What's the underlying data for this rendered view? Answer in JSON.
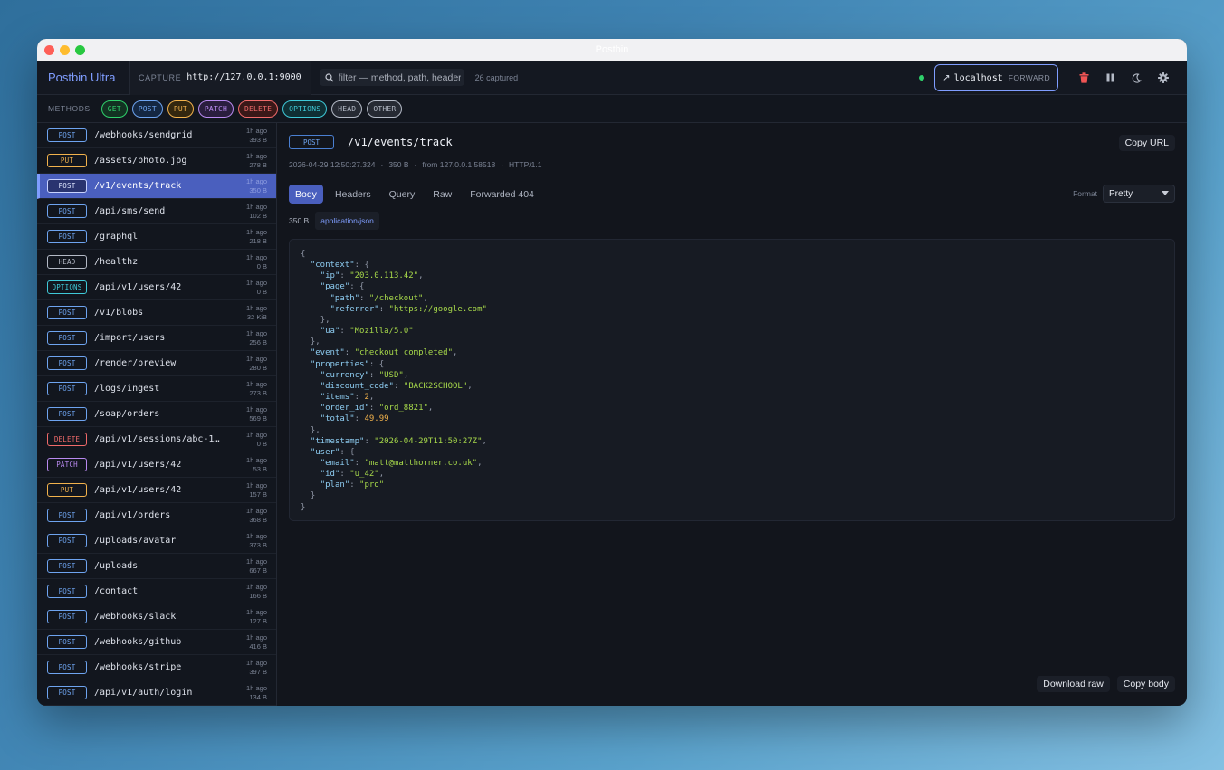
{
  "window": {
    "title": "Postbin"
  },
  "topbar": {
    "brand": "Postbin Ultra",
    "capture_label": "CAPTURE",
    "capture_url": "http://127.0.0.1:9000",
    "filter_placeholder": "filter — method, path, header",
    "captured_count": "26 captured",
    "status_color": "#2fd06b",
    "forward": {
      "arrow": "↗",
      "host": "localhost",
      "label": "FORWARD"
    },
    "icons": [
      "trash-icon",
      "pause-icon",
      "moon-icon",
      "gear-icon"
    ]
  },
  "methods": {
    "label": "METHODS",
    "chips": [
      {
        "label": "GET",
        "color": "#2fd06b",
        "bg": "#123222"
      },
      {
        "label": "POST",
        "color": "#6ea4f0",
        "bg": "#142742"
      },
      {
        "label": "PUT",
        "color": "#f2b24c",
        "bg": "#33270f"
      },
      {
        "label": "PATCH",
        "color": "#b98af0",
        "bg": "#2a1e3e"
      },
      {
        "label": "DELETE",
        "color": "#f06a6a",
        "bg": "#3a1818"
      },
      {
        "label": "OPTIONS",
        "color": "#3fc9d8",
        "bg": "#0f2f34"
      },
      {
        "label": "HEAD",
        "color": "#b4bac6",
        "bg": "#262a33"
      },
      {
        "label": "OTHER",
        "color": "#b4bac6",
        "bg": "#262a33"
      }
    ]
  },
  "requests": [
    {
      "method": "POST",
      "path": "/webhooks/sendgrid",
      "time": "1h ago",
      "size": "393 B"
    },
    {
      "method": "PUT",
      "path": "/assets/photo.jpg",
      "time": "1h ago",
      "size": "278 B"
    },
    {
      "method": "POST",
      "path": "/v1/events/track",
      "time": "1h ago",
      "size": "350 B",
      "selected": true
    },
    {
      "method": "POST",
      "path": "/api/sms/send",
      "time": "1h ago",
      "size": "102 B"
    },
    {
      "method": "POST",
      "path": "/graphql",
      "time": "1h ago",
      "size": "218 B"
    },
    {
      "method": "HEAD",
      "path": "/healthz",
      "time": "1h ago",
      "size": "0 B"
    },
    {
      "method": "OPTIONS",
      "path": "/api/v1/users/42",
      "time": "1h ago",
      "size": "0 B"
    },
    {
      "method": "POST",
      "path": "/v1/blobs",
      "time": "1h ago",
      "size": "32 KiB"
    },
    {
      "method": "POST",
      "path": "/import/users",
      "time": "1h ago",
      "size": "256 B"
    },
    {
      "method": "POST",
      "path": "/render/preview",
      "time": "1h ago",
      "size": "280 B"
    },
    {
      "method": "POST",
      "path": "/logs/ingest",
      "time": "1h ago",
      "size": "273 B"
    },
    {
      "method": "POST",
      "path": "/soap/orders",
      "time": "1h ago",
      "size": "569 B"
    },
    {
      "method": "DELETE",
      "path": "/api/v1/sessions/abc-1…",
      "time": "1h ago",
      "size": "0 B"
    },
    {
      "method": "PATCH",
      "path": "/api/v1/users/42",
      "time": "1h ago",
      "size": "53 B"
    },
    {
      "method": "PUT",
      "path": "/api/v1/users/42",
      "time": "1h ago",
      "size": "157 B"
    },
    {
      "method": "POST",
      "path": "/api/v1/orders",
      "time": "1h ago",
      "size": "368 B"
    },
    {
      "method": "POST",
      "path": "/uploads/avatar",
      "time": "1h ago",
      "size": "373 B"
    },
    {
      "method": "POST",
      "path": "/uploads",
      "time": "1h ago",
      "size": "667 B"
    },
    {
      "method": "POST",
      "path": "/contact",
      "time": "1h ago",
      "size": "166 B"
    },
    {
      "method": "POST",
      "path": "/webhooks/slack",
      "time": "1h ago",
      "size": "127 B"
    },
    {
      "method": "POST",
      "path": "/webhooks/github",
      "time": "1h ago",
      "size": "416 B"
    },
    {
      "method": "POST",
      "path": "/webhooks/stripe",
      "time": "1h ago",
      "size": "397 B"
    },
    {
      "method": "POST",
      "path": "/api/v1/auth/login",
      "time": "1h ago",
      "size": "134 B"
    }
  ],
  "detail": {
    "method": "POST",
    "path": "/v1/events/track",
    "copy_url": "Copy URL",
    "meta": [
      "2026-04-29 12:50:27.324",
      "350 B",
      "from 127.0.0.1:58518",
      "HTTP/1.1"
    ],
    "tabs": [
      "Body",
      "Headers",
      "Query",
      "Raw",
      "Forwarded 404"
    ],
    "active_tab": "Body",
    "format_label": "Format",
    "format_value": "Pretty",
    "body_size": "350 B",
    "content_type": "application/json",
    "download_raw": "Download raw",
    "copy_body": "Copy body",
    "json_body": [
      [
        [
          "p",
          "{"
        ]
      ],
      [
        [
          "i",
          1
        ],
        [
          "k",
          "\"context\""
        ],
        [
          "p",
          ": {"
        ]
      ],
      [
        [
          "i",
          2
        ],
        [
          "k",
          "\"ip\""
        ],
        [
          "p",
          ": "
        ],
        [
          "s",
          "\"203.0.113.42\""
        ],
        [
          "p",
          ","
        ]
      ],
      [
        [
          "i",
          2
        ],
        [
          "k",
          "\"page\""
        ],
        [
          "p",
          ": {"
        ]
      ],
      [
        [
          "i",
          3
        ],
        [
          "k",
          "\"path\""
        ],
        [
          "p",
          ": "
        ],
        [
          "s",
          "\"/checkout\""
        ],
        [
          "p",
          ","
        ]
      ],
      [
        [
          "i",
          3
        ],
        [
          "k",
          "\"referrer\""
        ],
        [
          "p",
          ": "
        ],
        [
          "s",
          "\"https://google.com\""
        ]
      ],
      [
        [
          "i",
          2
        ],
        [
          "p",
          "},"
        ]
      ],
      [
        [
          "i",
          2
        ],
        [
          "k",
          "\"ua\""
        ],
        [
          "p",
          ": "
        ],
        [
          "s",
          "\"Mozilla/5.0\""
        ]
      ],
      [
        [
          "i",
          1
        ],
        [
          "p",
          "},"
        ]
      ],
      [
        [
          "i",
          1
        ],
        [
          "k",
          "\"event\""
        ],
        [
          "p",
          ": "
        ],
        [
          "s",
          "\"checkout_completed\""
        ],
        [
          "p",
          ","
        ]
      ],
      [
        [
          "i",
          1
        ],
        [
          "k",
          "\"properties\""
        ],
        [
          "p",
          ": {"
        ]
      ],
      [
        [
          "i",
          2
        ],
        [
          "k",
          "\"currency\""
        ],
        [
          "p",
          ": "
        ],
        [
          "s",
          "\"USD\""
        ],
        [
          "p",
          ","
        ]
      ],
      [
        [
          "i",
          2
        ],
        [
          "k",
          "\"discount_code\""
        ],
        [
          "p",
          ": "
        ],
        [
          "s",
          "\"BACK2SCHOOL\""
        ],
        [
          "p",
          ","
        ]
      ],
      [
        [
          "i",
          2
        ],
        [
          "k",
          "\"items\""
        ],
        [
          "p",
          ": "
        ],
        [
          "n",
          "2"
        ],
        [
          "p",
          ","
        ]
      ],
      [
        [
          "i",
          2
        ],
        [
          "k",
          "\"order_id\""
        ],
        [
          "p",
          ": "
        ],
        [
          "s",
          "\"ord_8821\""
        ],
        [
          "p",
          ","
        ]
      ],
      [
        [
          "i",
          2
        ],
        [
          "k",
          "\"total\""
        ],
        [
          "p",
          ": "
        ],
        [
          "n",
          "49.99"
        ]
      ],
      [
        [
          "i",
          1
        ],
        [
          "p",
          "},"
        ]
      ],
      [
        [
          "i",
          1
        ],
        [
          "k",
          "\"timestamp\""
        ],
        [
          "p",
          ": "
        ],
        [
          "s",
          "\"2026-04-29T11:50:27Z\""
        ],
        [
          "p",
          ","
        ]
      ],
      [
        [
          "i",
          1
        ],
        [
          "k",
          "\"user\""
        ],
        [
          "p",
          ": {"
        ]
      ],
      [
        [
          "i",
          2
        ],
        [
          "k",
          "\"email\""
        ],
        [
          "p",
          ": "
        ],
        [
          "s",
          "\"matt@matthorner.co.uk\""
        ],
        [
          "p",
          ","
        ]
      ],
      [
        [
          "i",
          2
        ],
        [
          "k",
          "\"id\""
        ],
        [
          "p",
          ": "
        ],
        [
          "s",
          "\"u_42\""
        ],
        [
          "p",
          ","
        ]
      ],
      [
        [
          "i",
          2
        ],
        [
          "k",
          "\"plan\""
        ],
        [
          "p",
          ": "
        ],
        [
          "s",
          "\"pro\""
        ]
      ],
      [
        [
          "i",
          1
        ],
        [
          "p",
          "}"
        ]
      ],
      [
        [
          "p",
          "}"
        ]
      ]
    ]
  },
  "method_colors": {
    "GET": "#2fd06b",
    "POST": "#6ea4f0",
    "PUT": "#f2b24c",
    "PATCH": "#b98af0",
    "DELETE": "#f06a6a",
    "OPTIONS": "#3fc9d8",
    "HEAD": "#b4bac6",
    "OTHER": "#b4bac6"
  }
}
